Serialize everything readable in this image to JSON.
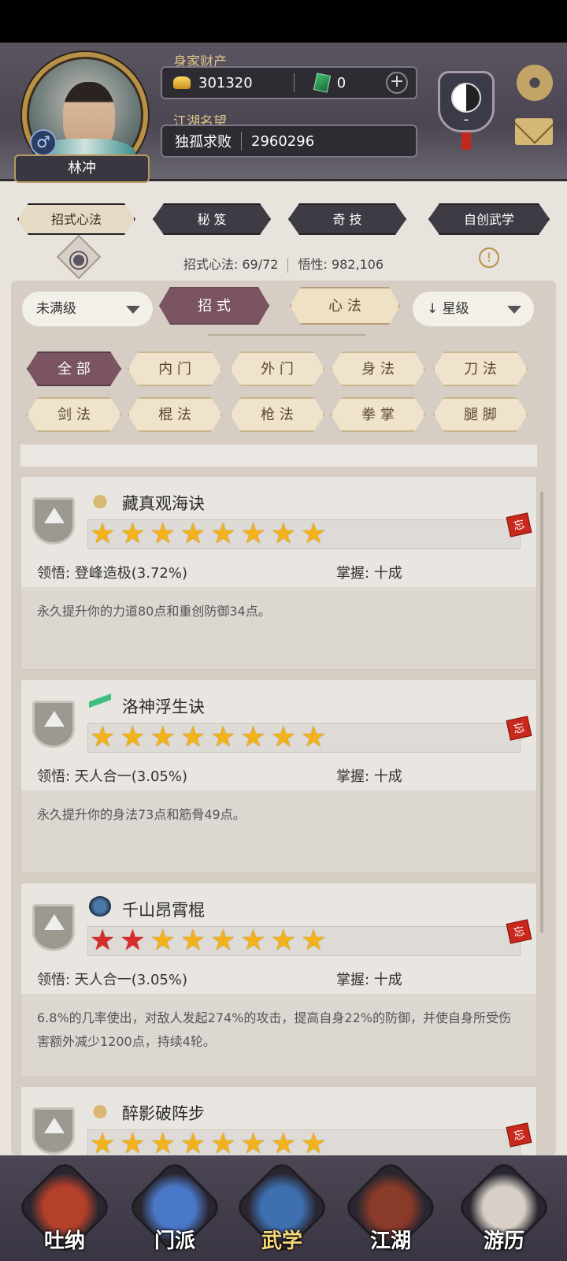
{
  "header": {
    "player_name": "林冲",
    "gender_symbol": "♂",
    "wealth_label": "身家财产",
    "gold": "301320",
    "jade": "0",
    "plus": "+",
    "fame_label": "江湖名望",
    "title": "独孤求败",
    "fame_value": "2960296",
    "emblem_text": "-"
  },
  "tabs": [
    {
      "label": "招式心法"
    },
    {
      "label": "秘 笈"
    },
    {
      "label": "奇 技"
    },
    {
      "label": "自创武学"
    }
  ],
  "info": {
    "moves_label": "招式心法: 69/72",
    "insight_label": "悟性: 982,106",
    "info_icon": "!"
  },
  "filters": {
    "level_filter": "未满级",
    "seg_moves": "招 式",
    "seg_methods": "心 法",
    "sort": "星级",
    "sort_arrow": "↓"
  },
  "categories": [
    "全 部",
    "内 门",
    "外 门",
    "身 法",
    "刀 法",
    "剑 法",
    "棍 法",
    "枪 法",
    "拳 掌",
    "腿 脚"
  ],
  "cards": [
    {
      "name": "藏真观海诀",
      "stars_red": 0,
      "stars_total": 8,
      "comprehension": "领悟: 登峰造极(3.72%)",
      "mastery": "掌握: 十成",
      "desc": "永久提升你的力道80点和重创防御34点。",
      "tag": "忘"
    },
    {
      "name": "洛神浮生诀",
      "stars_red": 0,
      "stars_total": 8,
      "comprehension": "领悟: 天人合一(3.05%)",
      "mastery": "掌握: 十成",
      "desc": "永久提升你的身法73点和筋骨49点。",
      "tag": "忘"
    },
    {
      "name": "千山昂霄棍",
      "stars_red": 2,
      "stars_total": 8,
      "comprehension": "领悟: 天人合一(3.05%)",
      "mastery": "掌握: 十成",
      "desc": "6.8%的几率使出，对敌人发起274%的攻击，提高自身22%的防御，并使自身所受伤害额外减少1200点，持续4轮。",
      "tag": "忘"
    },
    {
      "name": "醉影破阵步",
      "stars_red": 0,
      "stars_total": 8,
      "comprehension": "",
      "mastery": "",
      "desc": "",
      "tag": "忘"
    }
  ],
  "nav": [
    {
      "label": "吐纳",
      "color": "#b5402a"
    },
    {
      "label": "门派",
      "color": "#4a78c8"
    },
    {
      "label": "武学",
      "color": "#3e6fb0"
    },
    {
      "label": "江湖",
      "color": "#8a3a28"
    },
    {
      "label": "游历",
      "color": "#d8d0c8"
    }
  ],
  "colors": {
    "accent": "#7a5460",
    "gold_text": "#e0c58a",
    "star": "#f3b21a",
    "star_red": "#d82b2b"
  }
}
